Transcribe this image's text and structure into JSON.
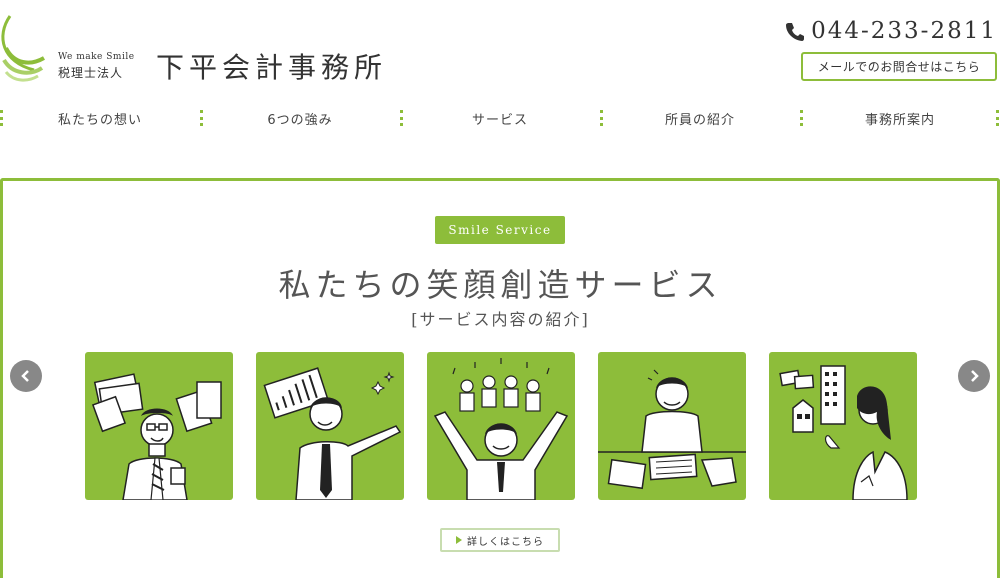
{
  "header": {
    "tagline": "We make Smile",
    "corp_type": "税理士法人",
    "office_name": "下平会計事務所",
    "phone_number": "044-233-2811",
    "mail_button_label": "メールでのお問合せはこちら"
  },
  "nav": {
    "items": [
      "私たちの想い",
      "6つの強み",
      "サービス",
      "所員の紹介",
      "事務所案内"
    ]
  },
  "main": {
    "badge": "Smile Service",
    "title": "私たちの笑顔創造サービス",
    "subtitle": "[サービス内容の紹介]",
    "details_button_label": "詳しくはこちら",
    "tile_illustrations": [
      "accountant-documents-illustration",
      "pointing-chart-illustration",
      "team-celebration-illustration",
      "desk-meeting-illustration",
      "property-consultation-illustration"
    ]
  },
  "colors": {
    "accent_green": "#8dbd3a",
    "arrow_gray": "#888888"
  }
}
